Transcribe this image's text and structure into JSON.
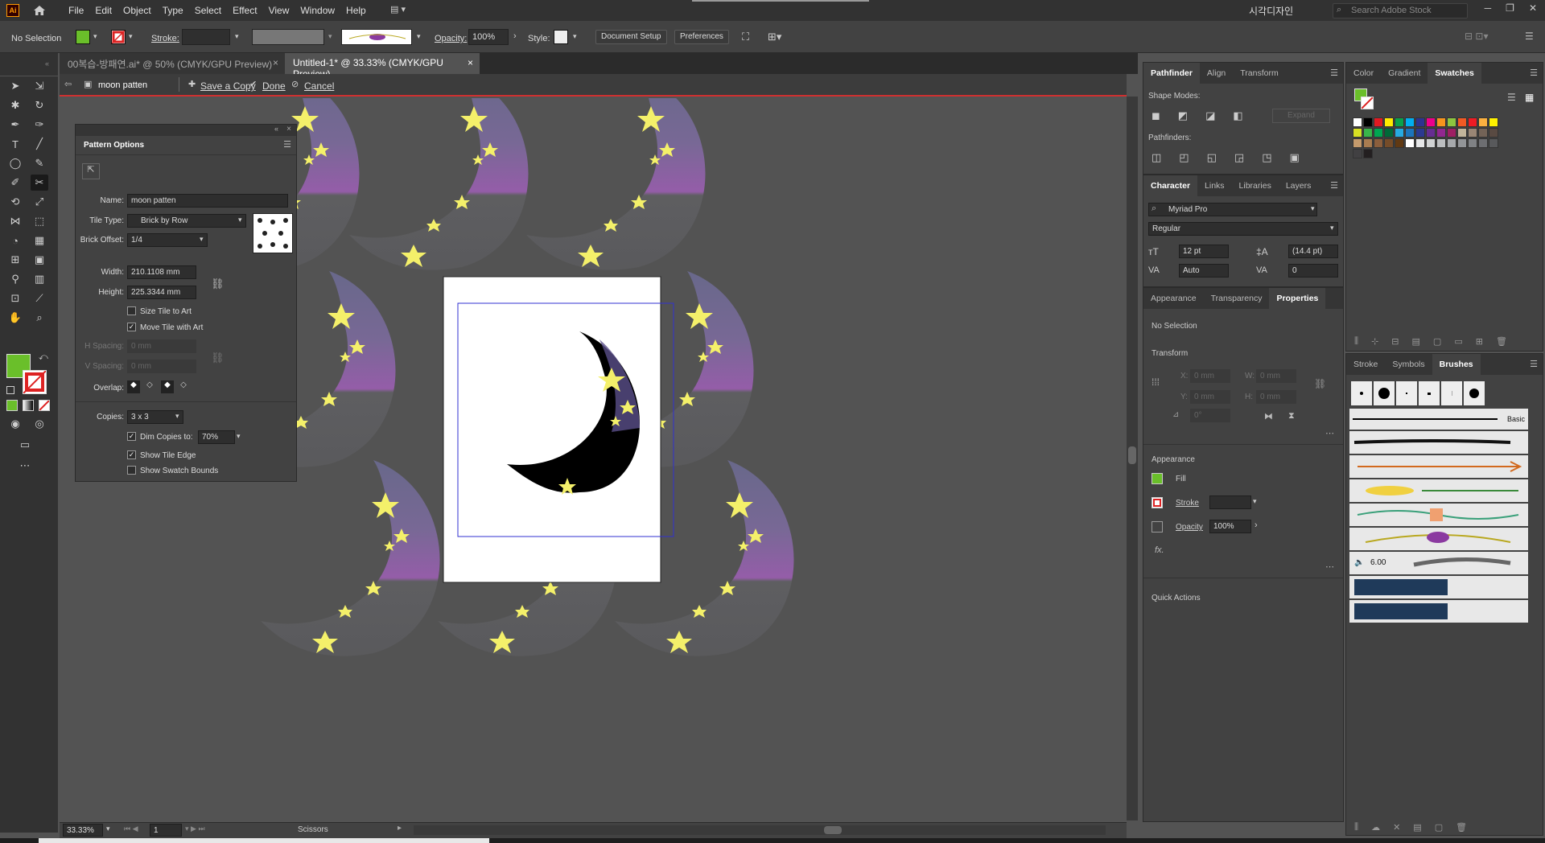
{
  "menubar": {
    "logo": "Ai",
    "items": [
      "File",
      "Edit",
      "Object",
      "Type",
      "Select",
      "Effect",
      "View",
      "Window",
      "Help"
    ],
    "workspace": "시각디자인",
    "stock_search_placeholder": "Search Adobe Stock"
  },
  "control": {
    "selection": "No Selection",
    "stroke_label": "Stroke:",
    "opacity_label": "Opacity:",
    "opacity_value": "100%",
    "style_label": "Style:",
    "document_setup": "Document Setup",
    "preferences": "Preferences",
    "fill_color": "#6abf2a"
  },
  "tabs": [
    {
      "label": "00복습-방패연.ai* @ 50% (CMYK/GPU Preview)",
      "active": false
    },
    {
      "label": "Untitled-1* @ 33.33% (CMYK/GPU Preview)",
      "active": true
    }
  ],
  "pattern_bar": {
    "name": "moon patten",
    "save_copy": "Save a Copy",
    "done": "Done",
    "cancel": "Cancel"
  },
  "pattern_options": {
    "title": "Pattern Options",
    "name_label": "Name:",
    "name_value": "moon patten",
    "tile_type_label": "Tile Type:",
    "tile_type_value": "Brick by Row",
    "brick_offset_label": "Brick Offset:",
    "brick_offset_value": "1/4",
    "width_label": "Width:",
    "width_value": "210.1108 mm",
    "height_label": "Height:",
    "height_value": "225.3344 mm",
    "size_tile": "Size Tile to Art",
    "move_tile": "Move Tile with Art",
    "h_spacing_label": "H Spacing:",
    "h_spacing_value": "0 mm",
    "v_spacing_label": "V Spacing:",
    "v_spacing_value": "0 mm",
    "overlap_label": "Overlap:",
    "copies_label": "Copies:",
    "copies_value": "3 x 3",
    "dim_copies": "Dim Copies to:",
    "dim_value": "70%",
    "show_tile_edge": "Show Tile Edge",
    "show_swatch_bounds": "Show Swatch Bounds"
  },
  "pathfinder": {
    "tabs": [
      "Pathfinder",
      "Align",
      "Transform"
    ],
    "shape_modes": "Shape Modes:",
    "expand": "Expand",
    "pathfinders": "Pathfinders:"
  },
  "character": {
    "tabs": [
      "Character",
      "Links",
      "Libraries",
      "Layers"
    ],
    "font": "Myriad Pro",
    "style": "Regular",
    "size": "12 pt",
    "leading": "(14.4 pt)",
    "kerning": "Auto",
    "tracking": "0"
  },
  "properties": {
    "tabs": [
      "Appearance",
      "Transparency",
      "Properties"
    ],
    "no_selection": "No Selection",
    "transform": "Transform",
    "x_label": "X:",
    "x_value": "0 mm",
    "y_label": "Y:",
    "y_value": "0 mm",
    "w_label": "W:",
    "w_value": "0 mm",
    "h_label": "H:",
    "h_value": "0 mm",
    "angle_value": "0°",
    "appearance": "Appearance",
    "fill": "Fill",
    "stroke": "Stroke",
    "opacity": "Opacity",
    "opacity_value": "100%",
    "fx": "fx.",
    "quick_actions": "Quick Actions"
  },
  "swatches": {
    "tabs": [
      "Color",
      "Gradient",
      "Swatches"
    ],
    "colors": [
      "#ffffff",
      "#000000",
      "#e11a22",
      "#ffeb00",
      "#0aa14b",
      "#01aeef",
      "#2d3390",
      "#ec008c",
      "#f7941d",
      "#8dc63f",
      "#f15a24",
      "#ed1c24",
      "#fbb040",
      "#fff200",
      "#d7df23",
      "#39b54a",
      "#00a651",
      "#006838",
      "#27aae1",
      "#1c75bc",
      "#2b3990",
      "#662d91",
      "#92278f",
      "#9e1f63",
      "#c2b59b",
      "#998675",
      "#736357",
      "#594a42",
      "#c49a6c",
      "#a97c50",
      "#8b5e3c",
      "#754c29",
      "#603913",
      "#ffffff",
      "#e6e7e8",
      "#d1d3d4",
      "#bcbec0",
      "#a7a9ac",
      "#939598",
      "#808285",
      "#6d6e71",
      "#58595b",
      "#414042",
      "#231f20"
    ]
  },
  "brushes": {
    "tabs": [
      "Stroke",
      "Symbols",
      "Brushes"
    ],
    "basic": "Basic",
    "size_value": "6.00"
  },
  "status": {
    "zoom": "33.33%",
    "artboard": "1",
    "tool": "Scissors"
  }
}
